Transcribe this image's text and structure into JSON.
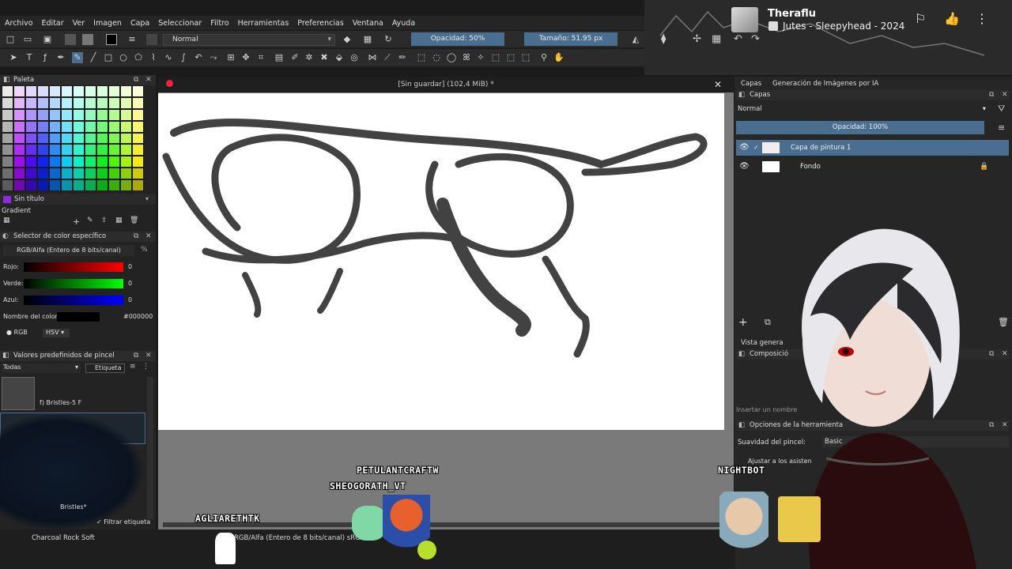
{
  "menu": [
    "Archivo",
    "Editar",
    "Ver",
    "Imagen",
    "Capa",
    "Seleccionar",
    "Filtro",
    "Herramientas",
    "Preferencias",
    "Ventana",
    "Ayuda"
  ],
  "toolbar": {
    "blend_mode": "Normal",
    "opacity": "Opacidad: 50%",
    "size": "Tamaño: 51.95 px"
  },
  "now_playing": {
    "artist": "Theraflu",
    "track": "Jutes - Sleepyhead - 2024"
  },
  "document": {
    "title": "[Sin guardar]  (102,4 MiB) *"
  },
  "left_panel": {
    "palette_title": "Paleta",
    "palette_name": "Sin título",
    "gradient_title": "Gradient",
    "color_selector_title": "Selector de color específico",
    "color_model": "RGB/Alfa (Entero de 8 bits/canal)",
    "percent_symbol": "%",
    "channels": [
      {
        "label": "Rojo:",
        "value": "0"
      },
      {
        "label": "Verde:",
        "value": "0"
      },
      {
        "label": "Azul:",
        "value": "0"
      }
    ],
    "color_name_label": "Nombre del color:",
    "color_hex": "#000000",
    "rgb_label": "RGB",
    "hsv_label": "HSV",
    "brush_presets_title": "Valores predefinidos de pincel",
    "brush_filter_all": "Todas",
    "brush_tag_label": "Etiqueta",
    "brush_name_1": "f) Bristles-5 F",
    "brush_name_2": "Bristles*",
    "filter_tag_label": "Filtrar etiqueta"
  },
  "right_panel": {
    "tab_layers": "Capas",
    "tab_ai": "Generación de Imágenes por IA",
    "layers_title": "Capas",
    "blend_mode": "Normal",
    "opacity": "Opacidad:  100%",
    "layers": [
      {
        "name": "Capa de pintura 1",
        "active": true
      },
      {
        "name": "Fondo",
        "active": false
      }
    ],
    "overview_label": "Vista genera",
    "composition_label": "Composició",
    "insert_name": "Insertar un nombre",
    "tool_options_title": "Opciones de la herramienta",
    "brush_smoothing": "Suavidad del pincel:",
    "smoothing_value": "Basic",
    "adjust_label": "Ajustar a los asisten"
  },
  "status_bar": {
    "brush": "Charcoal Rock Soft",
    "color_space": "RGB/Alfa (Entero de 8 bits/canal)  sRGB"
  },
  "chat": [
    {
      "name": "PETULANTCRAFTW"
    },
    {
      "name": "SHEOGORATH_VT"
    },
    {
      "name": "AGLIARETHTK"
    },
    {
      "name": "NIGHTBOT"
    }
  ],
  "colors": {
    "accent": "#4a6e8f",
    "panel": "#232323",
    "canvas": "#ffffff"
  }
}
